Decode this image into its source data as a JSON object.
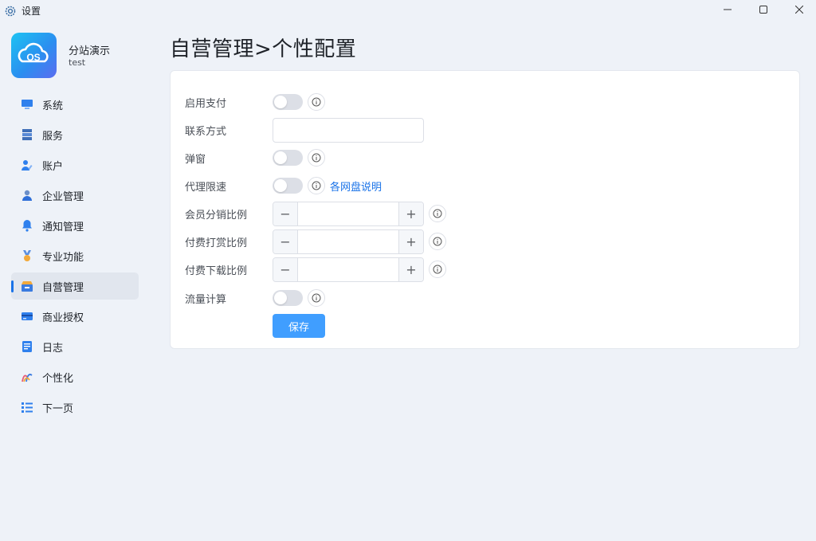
{
  "window": {
    "title": "设置",
    "app_icon": "gear-icon"
  },
  "profile": {
    "name": "分站演示",
    "subtitle": "test",
    "logo": "cloud-os-logo",
    "logo_text": "OS"
  },
  "sidebar": {
    "active_index": 6,
    "items": [
      {
        "label": "系统",
        "icon": "monitor-icon"
      },
      {
        "label": "服务",
        "icon": "server-icon"
      },
      {
        "label": "账户",
        "icon": "user-edit-icon"
      },
      {
        "label": "企业管理",
        "icon": "enterprise-user-icon"
      },
      {
        "label": "通知管理",
        "icon": "bell-icon"
      },
      {
        "label": "专业功能",
        "icon": "medal-icon"
      },
      {
        "label": "自营管理",
        "icon": "store-icon"
      },
      {
        "label": "商业授权",
        "icon": "card-icon"
      },
      {
        "label": "日志",
        "icon": "document-icon"
      },
      {
        "label": "个性化",
        "icon": "palette-icon"
      },
      {
        "label": "下一页",
        "icon": "list-icon"
      }
    ]
  },
  "page": {
    "title": "自营管理>个性配置"
  },
  "form": {
    "enable_payment": {
      "label": "启用支付",
      "enabled": false
    },
    "contact": {
      "label": "联系方式",
      "value": ""
    },
    "popup": {
      "label": "弹窗",
      "enabled": false
    },
    "proxy_limit": {
      "label": "代理限速",
      "enabled": false,
      "link_text": "各网盘说明"
    },
    "member_ratio": {
      "label": "会员分销比例",
      "value": ""
    },
    "tip_ratio": {
      "label": "付费打赏比例",
      "value": ""
    },
    "download_ratio": {
      "label": "付费下载比例",
      "value": ""
    },
    "traffic_calc": {
      "label": "流量计算",
      "enabled": false
    },
    "stepper_minus": "−",
    "stepper_plus": "+",
    "save_label": "保存"
  },
  "colors": {
    "accent": "#409eff",
    "link": "#1a73e8",
    "background": "#eef2f8"
  }
}
